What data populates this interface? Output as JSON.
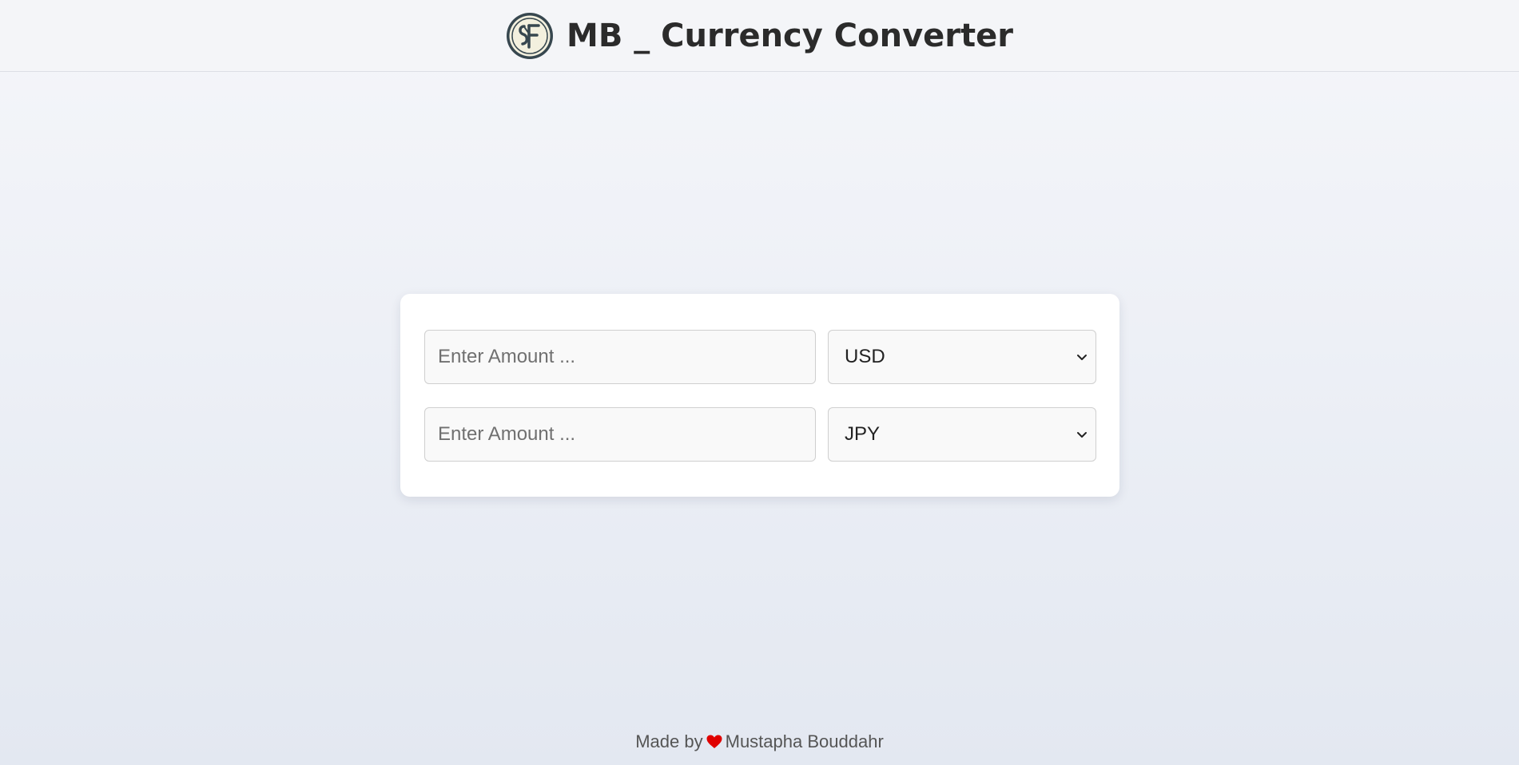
{
  "header": {
    "title": "MB _ Currency Converter",
    "logo_icon": "sf-monogram-logo-icon"
  },
  "converter": {
    "from": {
      "amount_value": "",
      "amount_placeholder": "Enter Amount ...",
      "currency": "USD"
    },
    "to": {
      "amount_value": "",
      "amount_placeholder": "Enter Amount ...",
      "currency": "JPY"
    }
  },
  "footer": {
    "prefix": "Made by",
    "heart_icon": "heart-icon",
    "author": "Mustapha Bouddahr"
  },
  "colors": {
    "heart": "#e00000",
    "title": "#2b2b2b",
    "card_bg": "#ffffff",
    "logo_dark": "#37474f",
    "logo_light": "#f3f0de"
  }
}
